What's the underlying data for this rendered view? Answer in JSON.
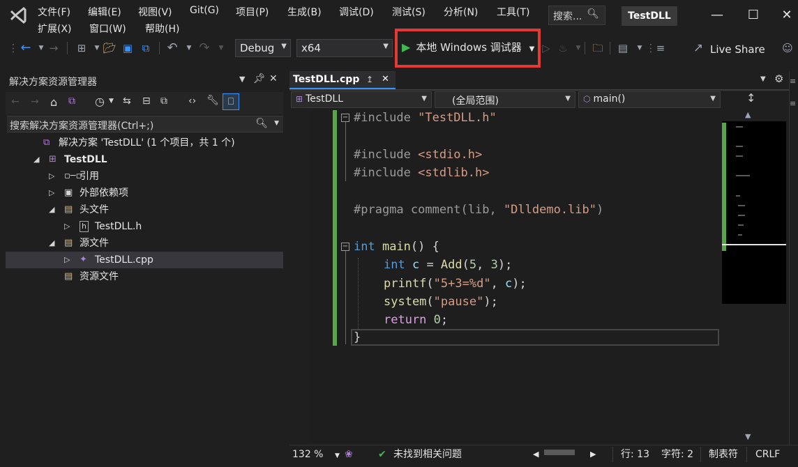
{
  "menu": {
    "items_row1": [
      "文件(F)",
      "编辑(E)",
      "视图(V)",
      "Git(G)",
      "项目(P)",
      "生成(B)",
      "调试(D)",
      "测试(S)",
      "分析(N)",
      "工具(T)"
    ],
    "items_row2": [
      "扩展(X)",
      "窗口(W)",
      "帮助(H)"
    ],
    "search_label": "搜索...",
    "solution_badge": "TestDLL"
  },
  "toolbar": {
    "config": "Debug",
    "platform": "x64",
    "run_label": "本地 Windows 调试器",
    "live_share": "Live Share"
  },
  "solution_explorer": {
    "title": "解决方案资源管理器",
    "search_placeholder": "搜索解决方案资源管理器(Ctrl+;)",
    "tree": [
      {
        "label": "解决方案 'TestDLL' (1 个项目，共 1 个)",
        "icon": "solution-icon",
        "arrow": ""
      },
      {
        "label": "TestDLL",
        "icon": "cpp-project-icon",
        "arrow": "expanded",
        "bold": true
      },
      {
        "label": "引用",
        "icon": "references-icon",
        "arrow": "collapsed"
      },
      {
        "label": "外部依赖项",
        "icon": "external-deps-icon",
        "arrow": "collapsed"
      },
      {
        "label": "头文件",
        "icon": "filter-folder-icon",
        "arrow": "expanded"
      },
      {
        "label": "TestDLL.h",
        "icon": "header-file-icon",
        "arrow": "collapsed"
      },
      {
        "label": "源文件",
        "icon": "filter-folder-icon",
        "arrow": "expanded"
      },
      {
        "label": "TestDLL.cpp",
        "icon": "cpp-file-icon",
        "arrow": "collapsed",
        "selected": true
      },
      {
        "label": "资源文件",
        "icon": "filter-folder-icon",
        "arrow": ""
      }
    ]
  },
  "editor": {
    "tab_label": "TestDLL.cpp",
    "nav_project": "TestDLL",
    "nav_scope": "(全局范围)",
    "nav_member": "main()",
    "code": {
      "l1_pp": "#include",
      "l1_str": " \"TestDLL.h\"",
      "l3_pp": "#include",
      "l3_str": " <stdio.h>",
      "l4_pp": "#include",
      "l4_str": " <stdlib.h>",
      "l6_pp": "#pragma comment(lib, ",
      "l6_str": "\"Dlldemo.lib\"",
      "l6_end": ")",
      "l8_kw": "int",
      "l8_fn": " main",
      "l8_rest": "() {",
      "l9_kw": "int",
      "l9_var": " c",
      "l9_eq": " = ",
      "l9_fn": "Add",
      "l9_open": "(",
      "l9_n1": "5",
      "l9_comma": ", ",
      "l9_n2": "3",
      "l9_close": ");",
      "l10_fn": "printf",
      "l10_open": "(",
      "l10_str": "\"5+3=%d\"",
      "l10_comma": ", ",
      "l10_var": "c",
      "l10_close": ");",
      "l11_fn": "system",
      "l11_open": "(",
      "l11_str": "\"pause\"",
      "l11_close": ");",
      "l12_kw": "return",
      "l12_sp": " ",
      "l12_num": "0",
      "l12_end": ";",
      "l13": "}"
    }
  },
  "status": {
    "zoom": "132 %",
    "issues": "未找到相关问题",
    "line": "行: 13",
    "char": "字符: 2",
    "indent": "制表符",
    "eol": "CRLF"
  },
  "colors": {
    "highlight_box": "#e53935",
    "change_bar": "#57a64a",
    "keyword": "#569cd6",
    "string": "#d69d85"
  }
}
